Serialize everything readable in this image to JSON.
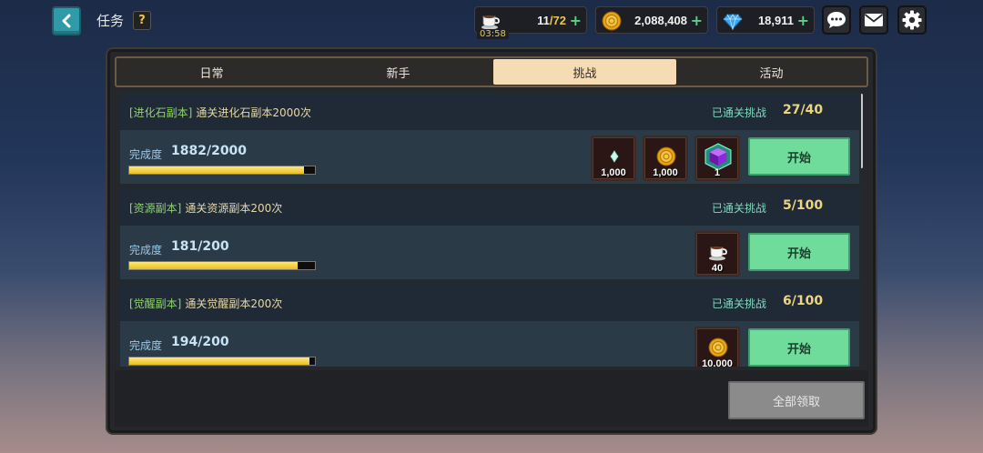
{
  "header": {
    "title": "任务",
    "help_label": "?"
  },
  "resources": {
    "stamina": {
      "icon": "coffee-cup-icon",
      "current": "11",
      "max": "/72",
      "timer": "03:58",
      "plus": "+"
    },
    "gold": {
      "icon": "gold-coin-icon",
      "value": "2,088,408",
      "plus": "+"
    },
    "gems": {
      "icon": "blue-diamond-icon",
      "value": "18,911",
      "plus": "+"
    }
  },
  "top_buttons": [
    "chat-icon",
    "mail-icon",
    "settings-gear-icon"
  ],
  "tabs": [
    {
      "label": "日常",
      "active": false
    },
    {
      "label": "新手",
      "active": false
    },
    {
      "label": "挑战",
      "active": true
    },
    {
      "label": "活动",
      "active": false
    }
  ],
  "quests": [
    {
      "category": "[进化石副本]",
      "description": "通关进化石副本2000次",
      "clear_label": "已通关挑战",
      "clear_value": "27/40",
      "progress_label": "完成度",
      "progress_value": "1882/2000",
      "progress_fraction": 0.941,
      "rewards": [
        {
          "icon": "evolution-crystal-icon",
          "qty": "1,000"
        },
        {
          "icon": "gold-coin-icon",
          "qty": "1,000"
        },
        {
          "icon": "purple-cube-icon",
          "qty": "1"
        }
      ],
      "button_label": "开始"
    },
    {
      "category": "[资源副本]",
      "description": "通关资源副本200次",
      "clear_label": "已通关挑战",
      "clear_value": "5/100",
      "progress_label": "完成度",
      "progress_value": "181/200",
      "progress_fraction": 0.905,
      "rewards": [
        {
          "icon": "coffee-cup-icon",
          "qty": "40"
        }
      ],
      "button_label": "开始"
    },
    {
      "category": "[觉醒副本]",
      "description": "通关觉醒副本200次",
      "clear_label": "已通关挑战",
      "clear_value": "6/100",
      "progress_label": "完成度",
      "progress_value": "194/200",
      "progress_fraction": 0.97,
      "rewards": [
        {
          "icon": "gold-coin-icon",
          "qty": "10,000"
        }
      ],
      "button_label": "开始"
    }
  ],
  "footer": {
    "claim_all_label": "全部领取"
  },
  "colors": {
    "start_button": "#6fdc9b",
    "active_tab": "#f6dcb4",
    "progress_fill": "#e9be24",
    "category_text": "#8ed36a",
    "clear_value_text": "#efd47f"
  }
}
